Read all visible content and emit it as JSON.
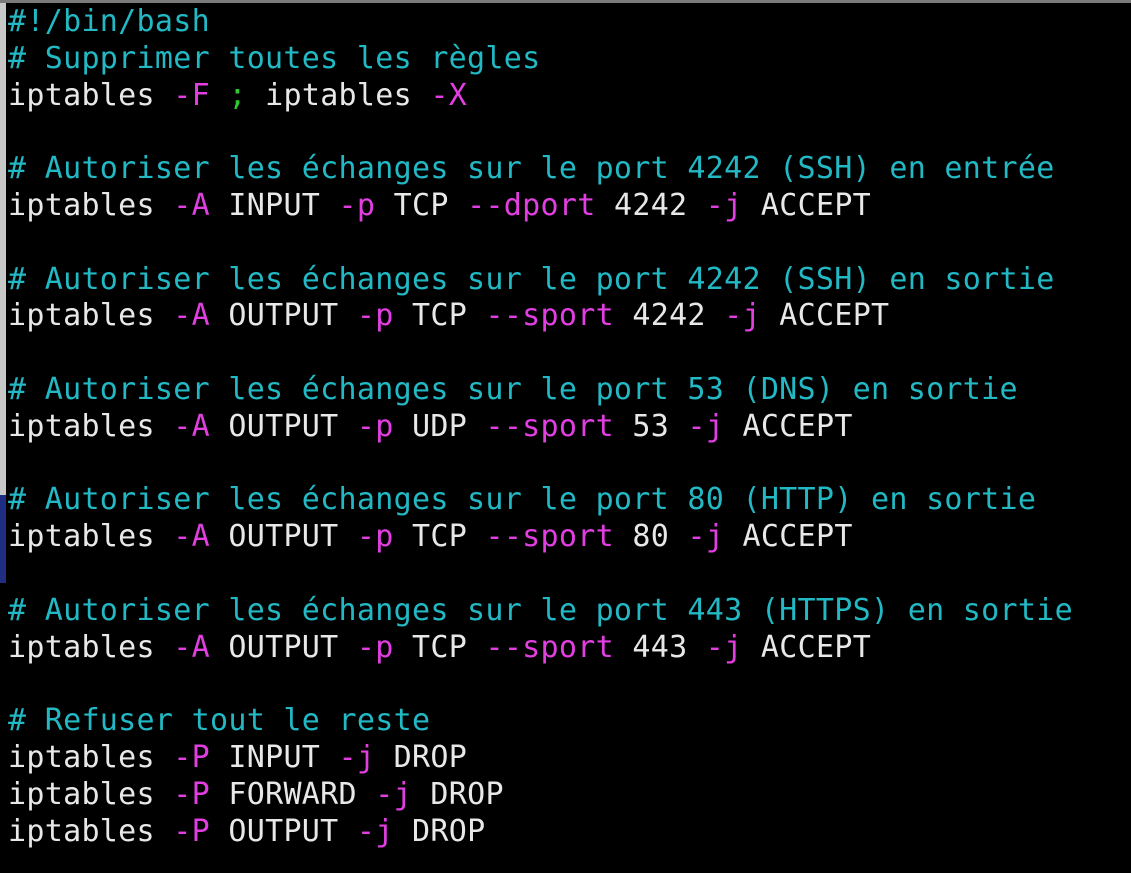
{
  "colors": {
    "background": "#000000",
    "comment": "#22b8c4",
    "command": "#e8e8e8",
    "flag": "#e23ee2",
    "separator": "#2ec92e"
  },
  "lines": [
    [
      {
        "t": "comment",
        "v": "#!/bin/bash"
      }
    ],
    [
      {
        "t": "comment",
        "v": "# Supprimer toutes les règles"
      }
    ],
    [
      {
        "t": "cmd",
        "v": "iptables "
      },
      {
        "t": "flag",
        "v": "-F"
      },
      {
        "t": "text",
        "v": " "
      },
      {
        "t": "sep",
        "v": ";"
      },
      {
        "t": "text",
        "v": " iptables "
      },
      {
        "t": "flag",
        "v": "-X"
      }
    ],
    [],
    [
      {
        "t": "comment",
        "v": "# Autoriser les échanges sur le port 4242 (SSH) en entrée"
      }
    ],
    [
      {
        "t": "cmd",
        "v": "iptables "
      },
      {
        "t": "flag",
        "v": "-A"
      },
      {
        "t": "text",
        "v": " INPUT "
      },
      {
        "t": "flag",
        "v": "-p"
      },
      {
        "t": "text",
        "v": " TCP "
      },
      {
        "t": "flag",
        "v": "--dport"
      },
      {
        "t": "text",
        "v": " 4242 "
      },
      {
        "t": "flag",
        "v": "-j"
      },
      {
        "t": "text",
        "v": " ACCEPT"
      }
    ],
    [],
    [
      {
        "t": "comment",
        "v": "# Autoriser les échanges sur le port 4242 (SSH) en sortie"
      }
    ],
    [
      {
        "t": "cmd",
        "v": "iptables "
      },
      {
        "t": "flag",
        "v": "-A"
      },
      {
        "t": "text",
        "v": " OUTPUT "
      },
      {
        "t": "flag",
        "v": "-p"
      },
      {
        "t": "text",
        "v": " TCP "
      },
      {
        "t": "flag",
        "v": "--sport"
      },
      {
        "t": "text",
        "v": " 4242 "
      },
      {
        "t": "flag",
        "v": "-j"
      },
      {
        "t": "text",
        "v": " ACCEPT"
      }
    ],
    [],
    [
      {
        "t": "comment",
        "v": "# Autoriser les échanges sur le port 53 (DNS) en sortie"
      }
    ],
    [
      {
        "t": "cmd",
        "v": "iptables "
      },
      {
        "t": "flag",
        "v": "-A"
      },
      {
        "t": "text",
        "v": " OUTPUT "
      },
      {
        "t": "flag",
        "v": "-p"
      },
      {
        "t": "text",
        "v": " UDP "
      },
      {
        "t": "flag",
        "v": "--sport"
      },
      {
        "t": "text",
        "v": " 53 "
      },
      {
        "t": "flag",
        "v": "-j"
      },
      {
        "t": "text",
        "v": " ACCEPT"
      }
    ],
    [],
    [
      {
        "t": "comment",
        "v": "# Autoriser les échanges sur le port 80 (HTTP) en sortie"
      }
    ],
    [
      {
        "t": "cmd",
        "v": "iptables "
      },
      {
        "t": "flag",
        "v": "-A"
      },
      {
        "t": "text",
        "v": " OUTPUT "
      },
      {
        "t": "flag",
        "v": "-p"
      },
      {
        "t": "text",
        "v": " TCP "
      },
      {
        "t": "flag",
        "v": "--sport"
      },
      {
        "t": "text",
        "v": " 80 "
      },
      {
        "t": "flag",
        "v": "-j"
      },
      {
        "t": "text",
        "v": " ACCEPT"
      }
    ],
    [],
    [
      {
        "t": "comment",
        "v": "# Autoriser les échanges sur le port 443 (HTTPS) en sortie"
      }
    ],
    [
      {
        "t": "cmd",
        "v": "iptables "
      },
      {
        "t": "flag",
        "v": "-A"
      },
      {
        "t": "text",
        "v": " OUTPUT "
      },
      {
        "t": "flag",
        "v": "-p"
      },
      {
        "t": "text",
        "v": " TCP "
      },
      {
        "t": "flag",
        "v": "--sport"
      },
      {
        "t": "text",
        "v": " 443 "
      },
      {
        "t": "flag",
        "v": "-j"
      },
      {
        "t": "text",
        "v": " ACCEPT"
      }
    ],
    [],
    [
      {
        "t": "comment",
        "v": "# Refuser tout le reste"
      }
    ],
    [
      {
        "t": "cmd",
        "v": "iptables "
      },
      {
        "t": "flag",
        "v": "-P"
      },
      {
        "t": "text",
        "v": " INPUT "
      },
      {
        "t": "flag",
        "v": "-j"
      },
      {
        "t": "text",
        "v": " DROP"
      }
    ],
    [
      {
        "t": "cmd",
        "v": "iptables "
      },
      {
        "t": "flag",
        "v": "-P"
      },
      {
        "t": "text",
        "v": " FORWARD "
      },
      {
        "t": "flag",
        "v": "-j"
      },
      {
        "t": "text",
        "v": " DROP"
      }
    ],
    [
      {
        "t": "cmd",
        "v": "iptables "
      },
      {
        "t": "flag",
        "v": "-P"
      },
      {
        "t": "text",
        "v": " OUTPUT "
      },
      {
        "t": "flag",
        "v": "-j"
      },
      {
        "t": "text",
        "v": " DROP"
      }
    ]
  ]
}
